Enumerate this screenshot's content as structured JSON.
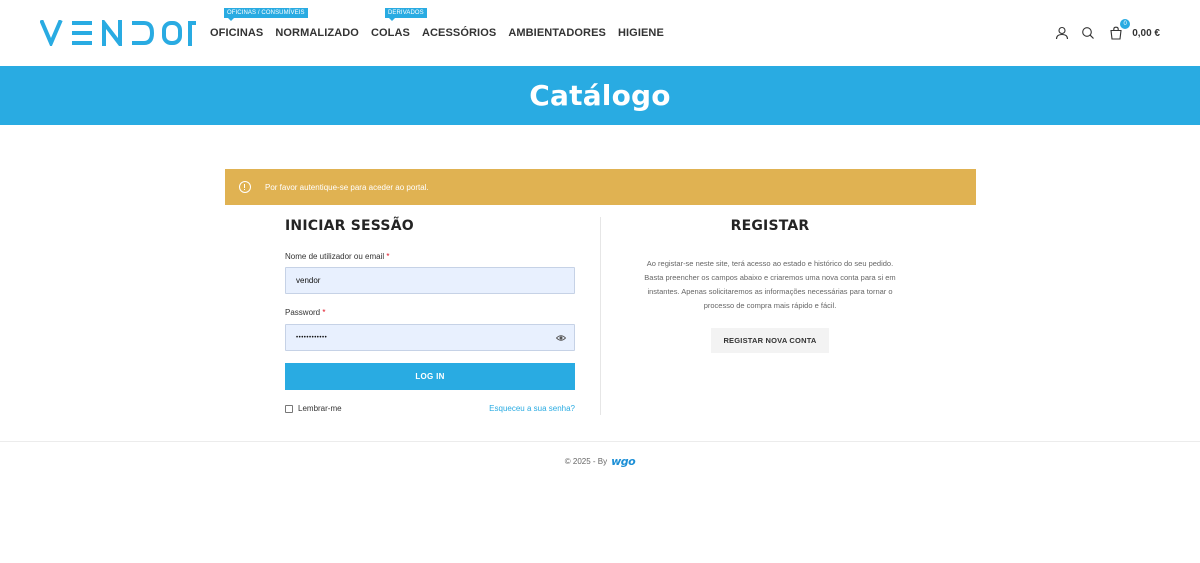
{
  "header": {
    "logo_text": "VENDOR",
    "nav": [
      {
        "label": "OFICINAS",
        "badge": "OFICINAS / CONSUMÍVEIS"
      },
      {
        "label": "NORMALIZADO",
        "badge": ""
      },
      {
        "label": "COLAS",
        "badge": "DERIVADOS"
      },
      {
        "label": "ACESSÓRIOS",
        "badge": ""
      },
      {
        "label": "AMBIENTADORES",
        "badge": ""
      },
      {
        "label": "HIGIENE",
        "badge": ""
      }
    ],
    "icons": [
      "user-icon",
      "search-icon",
      "cart-icon"
    ],
    "cart_count": "0",
    "cart_total": "0,00 €"
  },
  "page_title": "Catálogo",
  "notice": {
    "icon": "info-icon",
    "text": "Por favor autentique-se para aceder ao portal."
  },
  "login": {
    "title": "INICIAR SESSÃO",
    "username_label": "Nome de utilizador ou email",
    "required_mark": "*",
    "username_value": "vendor",
    "password_label": "Password",
    "password_value": "••••••••••••",
    "login_button": "LOG IN",
    "remember_label": "Lembrar-me",
    "forgot_link": "Esqueceu a sua senha?"
  },
  "register": {
    "title": "REGISTAR",
    "lines": [
      "Ao registar-se neste site, terá acesso ao estado e histórico do seu pedido.",
      "Basta preencher os campos abaixo e criaremos uma nova conta para si em",
      "instantes. Apenas solicitaremos as informações necessárias para tornar o",
      "processo de compra mais rápido e fácil."
    ],
    "button": "REGISTAR NOVA CONTA"
  },
  "footer": {
    "text": "© 2025 - By",
    "brand": "wgo"
  },
  "colors": {
    "accent": "#29abe2",
    "notice": "#e0b252",
    "input_bg": "#e8f0fe"
  }
}
